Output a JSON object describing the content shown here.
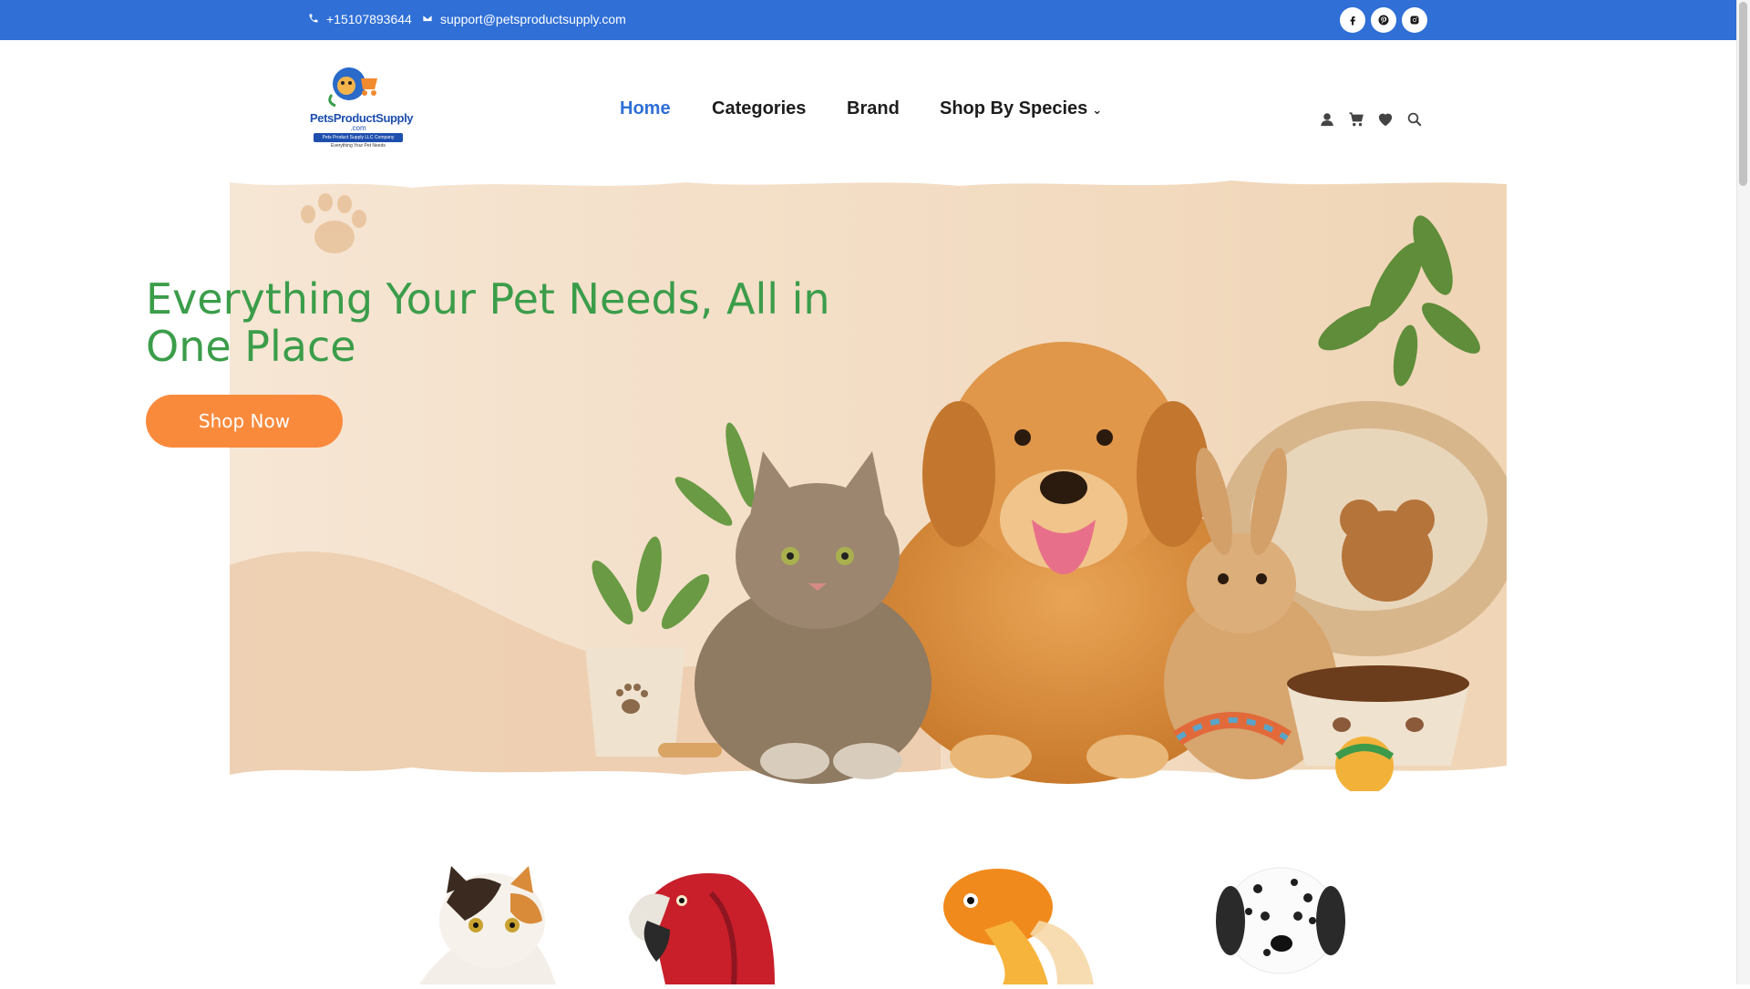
{
  "topbar": {
    "phone": "+15107893644",
    "email": "support@petsproductsupply.com",
    "social": [
      {
        "icon": "facebook-icon",
        "label": "f"
      },
      {
        "icon": "pinterest-icon",
        "label": "p"
      },
      {
        "icon": "instagram-icon",
        "label": "ig"
      }
    ]
  },
  "logo": {
    "line1": "PetsProductSupply",
    "line2": ".com",
    "line3": "Pets Product Supply LLC Company",
    "line4": "Everything Your Pet Needs"
  },
  "nav": {
    "items": [
      "Home",
      "Categories",
      "Brand",
      "Shop By Species"
    ],
    "active": "Home"
  },
  "header_icons": [
    "user-icon",
    "cart-icon",
    "heart-icon",
    "search-icon"
  ],
  "hero": {
    "title": "Everything Your Pet Needs, All in One Place",
    "button": "Shop Now"
  },
  "species": [
    "cat",
    "parrot",
    "fish",
    "dog"
  ],
  "colors": {
    "topbar": "#2f6fd6",
    "nav_active": "#2f6fd6",
    "hero_title": "#3b9d4a",
    "button": "#f98a3c",
    "hero_bg": "#f3dcc3"
  }
}
